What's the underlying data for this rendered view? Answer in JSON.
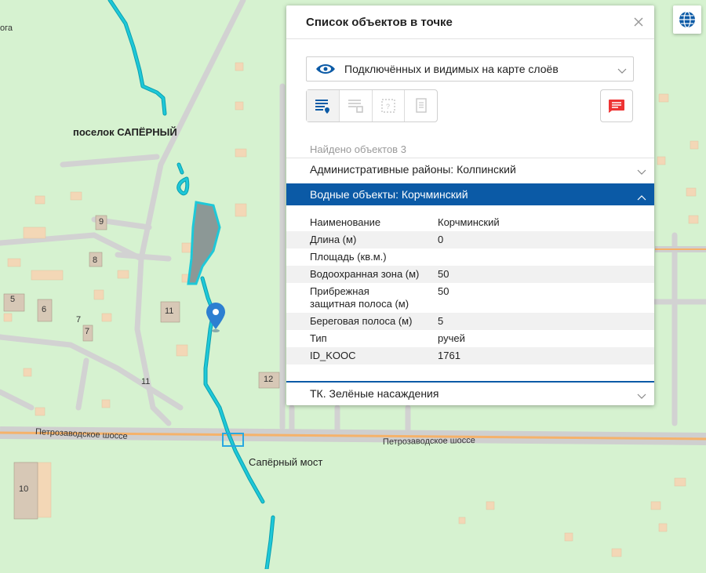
{
  "map": {
    "settlement_label": "поселок САПЁРНЫЙ",
    "partial_label_left": "ога",
    "road_label_left": "Петрозаводское шоссе",
    "road_label_right": "Петрозаводское шоссе",
    "bridge_label": "Сапёрный мост",
    "building_numbers": [
      "9",
      "8",
      "5",
      "6",
      "7",
      "7",
      "11",
      "11",
      "12",
      "10"
    ],
    "colors": {
      "ground": "#d6f2d0",
      "road": "#cfcfcf",
      "highway": "#f5b26a",
      "water_stroke": "#1ec8d8",
      "building": "#f3d7b6",
      "marker": "#2d7fd1"
    }
  },
  "panel": {
    "title": "Список объектов в точке",
    "layer_select_value": "Подключённых и видимых на карте слоёв",
    "found_text": "Найдено объектов 3",
    "groups": [
      {
        "label": "Административные районы: Колпинский",
        "selected": false
      },
      {
        "label": "Водные объекты: Корчминский",
        "selected": true
      },
      {
        "label": "ТК. Зелёные насаждения",
        "selected": false
      }
    ],
    "attributes": [
      {
        "key": "Наименование",
        "value": "Корчминский"
      },
      {
        "key": "Длина (м)",
        "value": "0"
      },
      {
        "key": "Площадь (кв.м.)",
        "value": ""
      },
      {
        "key": "Водоохранная зона (м)",
        "value": "50"
      },
      {
        "key": "Прибрежная защитная полоса (м)",
        "value": "50"
      },
      {
        "key": "Береговая полоса (м)",
        "value": "5"
      },
      {
        "key": "Тип",
        "value": "ручей"
      },
      {
        "key": "ID_KOOC",
        "value": "1761"
      }
    ],
    "accent_color": "#0b5aa6"
  }
}
